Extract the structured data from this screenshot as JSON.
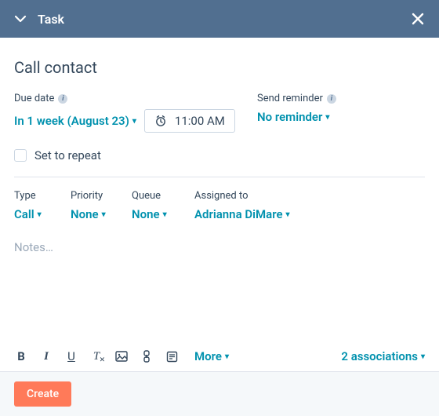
{
  "header": {
    "title": "Task"
  },
  "task": {
    "title": "Call contact",
    "due": {
      "label": "Due date",
      "date_display": "In 1 week (August 23)",
      "time": "11:00 AM"
    },
    "reminder": {
      "label": "Send reminder",
      "value": "No reminder"
    },
    "repeat": {
      "label": "Set to repeat",
      "checked": false
    }
  },
  "fields": {
    "type": {
      "label": "Type",
      "value": "Call"
    },
    "priority": {
      "label": "Priority",
      "value": "None"
    },
    "queue": {
      "label": "Queue",
      "value": "None"
    },
    "assigned": {
      "label": "Assigned to",
      "value": "Adrianna DiMare"
    }
  },
  "notes": {
    "placeholder": "Notes…"
  },
  "toolbar": {
    "more": "More"
  },
  "associations": {
    "label": "2 associations"
  },
  "footer": {
    "create": "Create"
  }
}
